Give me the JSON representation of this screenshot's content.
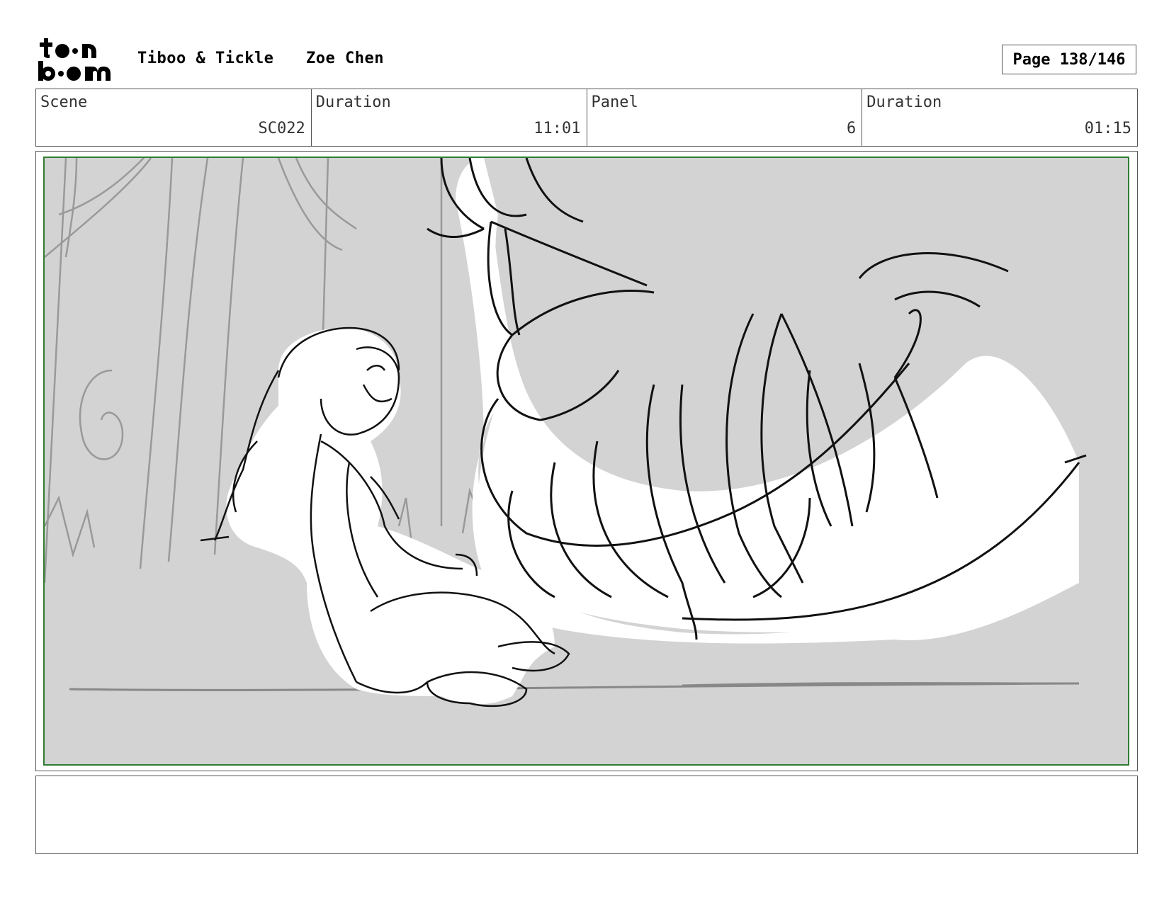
{
  "header": {
    "logo": {
      "line1": "toon",
      "line2": "boom",
      "icon": "toonboom-logo"
    },
    "project_title": "Tiboo & Tickle",
    "author": "Zoe Chen",
    "page": "Page 138/146"
  },
  "info": {
    "scene_label": "Scene",
    "scene_value": "SC022",
    "scene_duration_label": "Duration",
    "scene_duration_value": "11:01",
    "panel_label": "Panel",
    "panel_value": "6",
    "panel_duration_label": "Duration",
    "panel_duration_value": "01:15"
  },
  "panel": {
    "image": "storyboard-sketch-girl-and-creature",
    "frame_color": "#2f7d32",
    "background_color": "#d3d3d3"
  },
  "notes": {
    "text": ""
  }
}
